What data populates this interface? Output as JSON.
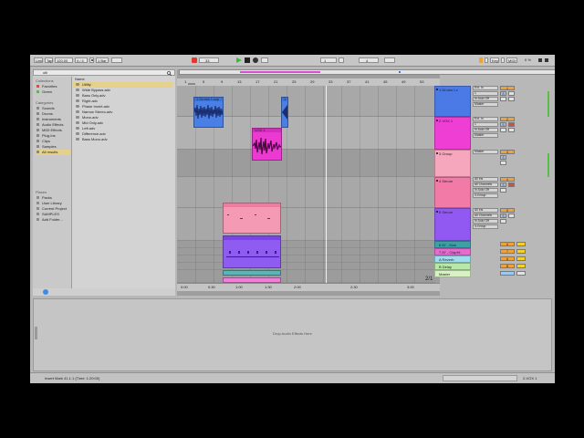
{
  "toolbar": {
    "link_label": "Link",
    "tap_label": "Tap",
    "tempo": "120.00",
    "meter": "4 / 4",
    "quantize": "1 Bar",
    "position": "33",
    "loop_start": "1",
    "loop_length": "4",
    "key_label": "Key",
    "midi_label": "MIDI",
    "cpu": "0 %",
    "colors": {
      "play": "#2fbf3a",
      "record": "#e23b2e",
      "accent": "#f0a23a"
    }
  },
  "browser": {
    "search_placeholder": "util",
    "collections_header": "Collections",
    "collections": [
      {
        "label": "Favorites",
        "color": "#e2483e"
      },
      {
        "label": "Green",
        "color": "#4fbf4a"
      }
    ],
    "categories_header": "Categories",
    "categories": [
      "Sounds",
      "Drums",
      "Instruments",
      "Audio Effects",
      "MIDI Effects",
      "Plug-Ins",
      "Clips",
      "Samples",
      "All results"
    ],
    "selected_category": "All results",
    "places_header": "Places",
    "places": [
      "Packs",
      "User Library",
      "Current Project",
      "SAMPLES",
      "Add Folder..."
    ],
    "name_header": "Name",
    "files": [
      "Utility",
      "Wide Bypass.adv",
      "Bass Only.adv",
      "Right.adv",
      "Phase Invert.adv",
      "Narrow Stereo.adv",
      "Mono.adv",
      "Mid Only.adv",
      "Left.adv",
      "Difference.adv",
      "Bass Mono.adv"
    ],
    "selected_file": "Utility"
  },
  "arrangement": {
    "ruler_labels": [
      "1",
      "5",
      "9",
      "13",
      "17",
      "21",
      "25",
      "29",
      "33",
      "37",
      "41",
      "45",
      "49",
      "53"
    ],
    "time_labels": [
      "0:00",
      "0:30",
      "1:00",
      "1:30",
      "2:00",
      "2:30",
      "3:00"
    ],
    "zoom": "2/1",
    "clips": {
      "c1": {
        "name": "1 Drums Loop",
        "color": "#3a74e0"
      },
      "c1b": {
        "name": "1",
        "color": "#3a74e0"
      },
      "c2": {
        "name": "VOX 1",
        "color": "#e63ad0"
      },
      "c4": {
        "name": "",
        "color": "#f07ca0"
      },
      "c5": {
        "name": "",
        "color": "#8d5cf0"
      }
    }
  },
  "tracks": [
    {
      "name": "1 Drums Lo",
      "color": "#4b7ae6",
      "input": "Ext. In",
      "input2": "1",
      "monitor": "In Auto Off",
      "output": "Master",
      "num": "1",
      "sends": [
        "S"
      ]
    },
    {
      "name": "2 VOX 1",
      "color": "#ef3ed4",
      "input": "Ext. In",
      "input2": "1",
      "monitor": "In Auto Off",
      "output": "Master",
      "num": "2",
      "sends": [
        "S"
      ]
    },
    {
      "name": "3 Group",
      "color": "#f6a6bd",
      "input": "",
      "input2": "",
      "monitor": "",
      "output": "Master",
      "num": "3",
      "sends": [
        "S"
      ]
    },
    {
      "name": "4 Serum",
      "color": "#f27aa6",
      "input": "All Ins",
      "input2": "All Channels",
      "monitor": "In Auto Off",
      "output": "3-Group",
      "num": "4",
      "sends": [
        "S"
      ]
    },
    {
      "name": "5 Serum",
      "color": "#9159f2",
      "input": "All Ins",
      "input2": "All Channels",
      "monitor": "In Auto Off",
      "output": "3-Group",
      "num": "5",
      "sends": [
        "S"
      ]
    },
    {
      "name": "6 87 - Kick",
      "color": "#3aa1a8",
      "num": "6"
    },
    {
      "name": "7 87 - ClapHi",
      "color": "#e66bd0",
      "num": "7"
    },
    {
      "name": "A Reverb",
      "color": "#9fdcf0",
      "num": "A"
    },
    {
      "name": "B Delay",
      "color": "#b6e9a8",
      "num": "B"
    },
    {
      "name": "Master",
      "color": "#d9f2c4",
      "num": ""
    }
  ],
  "detail": {
    "drop_text": "Drop Audio Effects Here"
  },
  "status": {
    "message": "Insert Mark 41.1.1 (Time: 1:20:00)",
    "track_name": "2-VOX 1"
  }
}
